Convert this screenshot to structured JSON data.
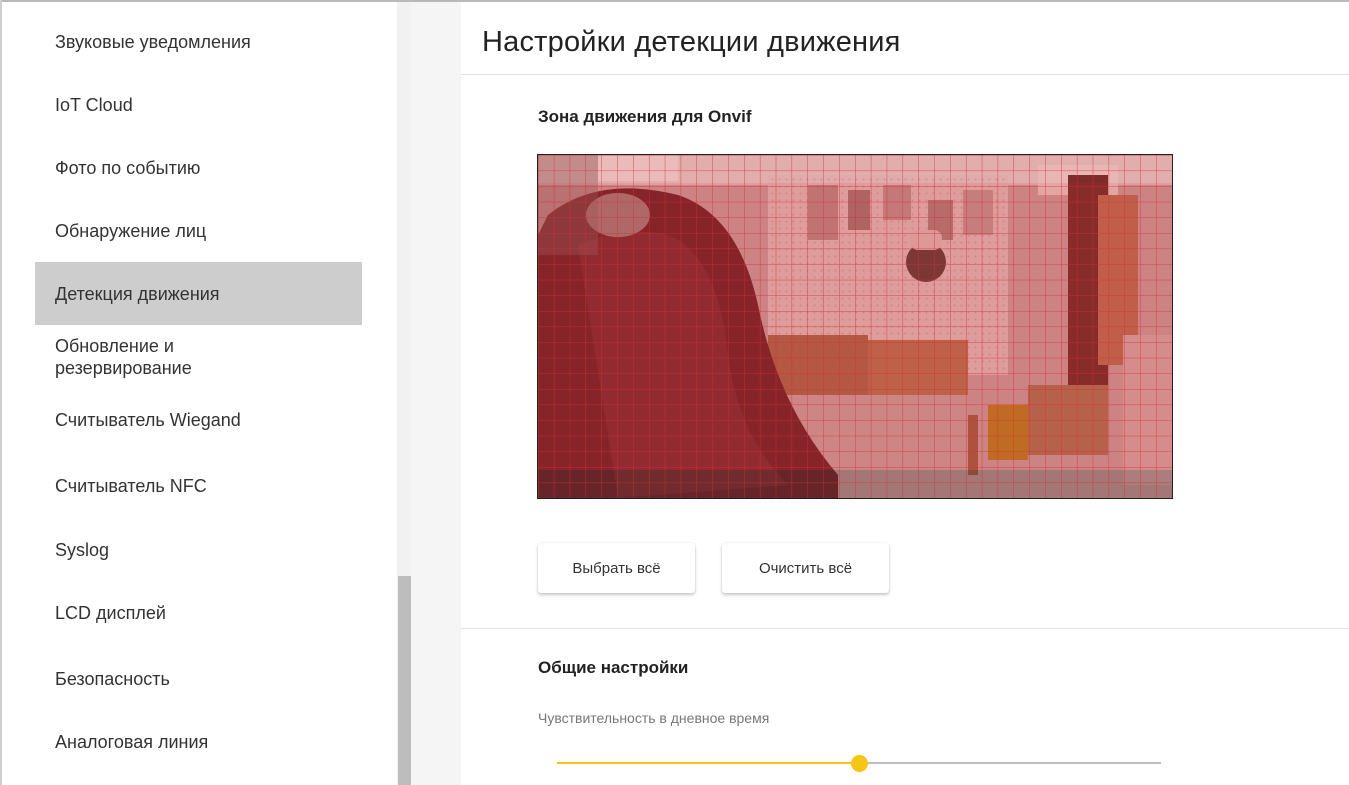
{
  "sidebar": {
    "items": [
      {
        "label": "Звуковые уведомления"
      },
      {
        "label": "IoT Cloud"
      },
      {
        "label": "Фото по событию"
      },
      {
        "label": "Обнаружение лиц"
      },
      {
        "label": "Детекция движения",
        "active": true
      },
      {
        "label": "Обновление и резервирование"
      },
      {
        "label": "Считыватель Wiegand"
      },
      {
        "label": "Считыватель NFC"
      },
      {
        "label": "Syslog"
      },
      {
        "label": "LCD дисплей"
      },
      {
        "label": "Безопасность"
      },
      {
        "label": "Аналоговая линия"
      }
    ]
  },
  "main": {
    "title": "Настройки детекции движения",
    "zone_section": {
      "title": "Зона движения для Onvif",
      "select_all_label": "Выбрать всё",
      "clear_all_label": "Очистить всё"
    },
    "general_section": {
      "title": "Общие настройки",
      "day_sensitivity_label": "Чувствительность в дневное время",
      "day_sensitivity_fraction": 0.5
    }
  },
  "colors": {
    "accent": "#f5c518",
    "active_item_bg": "#cdcdcd",
    "zone_overlay": "#d32f2f"
  }
}
